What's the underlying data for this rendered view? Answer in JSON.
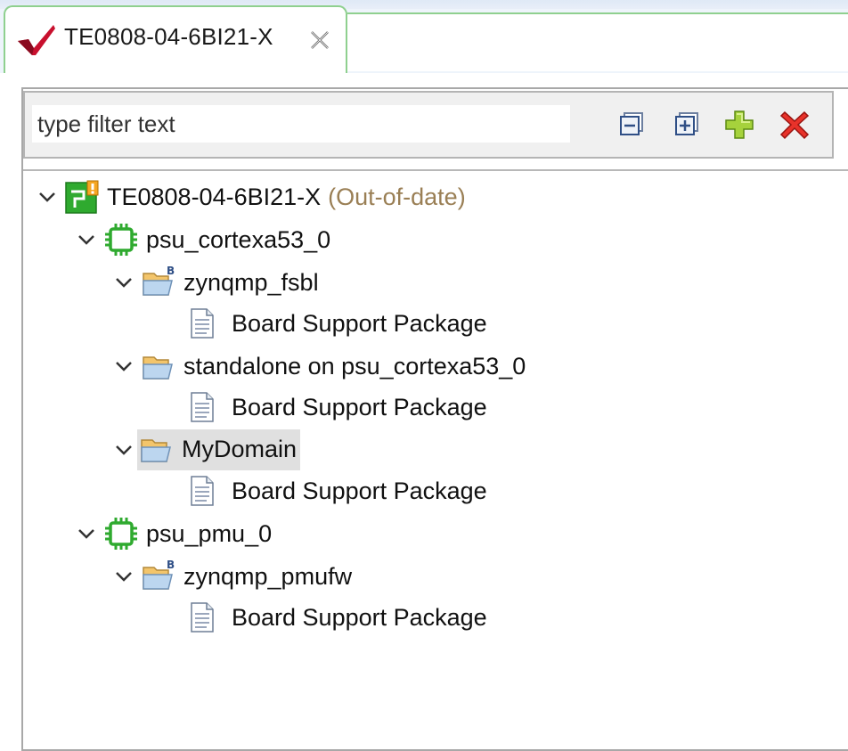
{
  "tab": {
    "title": "TE0808-04-6BI21-X"
  },
  "filter": {
    "placeholder": "type filter text"
  },
  "toolbar": {
    "collapse_icon": "collapse-all-icon",
    "expand_icon": "expand-all-icon",
    "add_icon": "add-icon",
    "remove_icon": "remove-icon"
  },
  "tree": {
    "platform": {
      "label": "TE0808-04-6BI21-X",
      "status": "(Out-of-date)"
    },
    "proc1": {
      "label": "psu_cortexa53_0"
    },
    "domain1": {
      "label": "zynqmp_fsbl",
      "child": "Board Support Package"
    },
    "domain2": {
      "label": "standalone on psu_cortexa53_0",
      "child": "Board Support Package"
    },
    "domain3": {
      "label": "MyDomain",
      "child": "Board Support Package"
    },
    "proc2": {
      "label": "psu_pmu_0"
    },
    "domain4": {
      "label": "zynqmp_pmufw",
      "child": "Board Support Package"
    }
  },
  "colors": {
    "tab_border": "#8fd08f",
    "status_text": "#9a7f55",
    "chip_green": "#2faa2f",
    "folder_yellow": "#f3c56b",
    "remove_red": "#e8322a"
  }
}
